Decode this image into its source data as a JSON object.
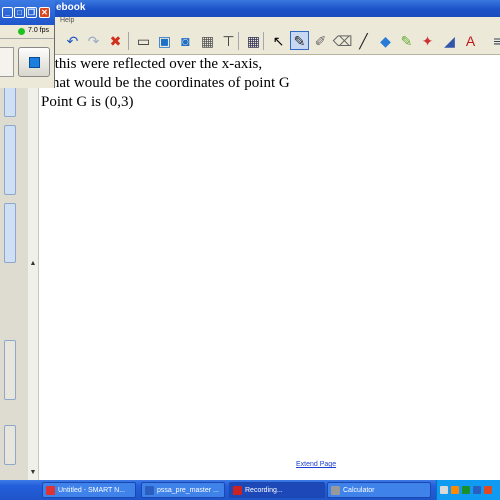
{
  "window": {
    "title_fragment": "ebook",
    "menu_help": "Help"
  },
  "toolbar": {
    "items": [
      {
        "name": "undo-icon",
        "glyph": "↶",
        "color": "#1e55c4"
      },
      {
        "name": "redo-icon",
        "glyph": "↷",
        "color": "#9aa9c4"
      },
      {
        "name": "delete-icon",
        "glyph": "✖",
        "color": "#d0301c"
      },
      {
        "name": "screen-shade-icon",
        "glyph": "▭",
        "color": "#333"
      },
      {
        "name": "display-icon",
        "glyph": "▣",
        "color": "#1e6fc8"
      },
      {
        "name": "projector-icon",
        "glyph": "◙",
        "color": "#1e6fc8"
      },
      {
        "name": "screen-capture-icon",
        "glyph": "▦",
        "color": "#555"
      },
      {
        "name": "tool-icon",
        "glyph": "⊤",
        "color": "#333"
      },
      {
        "name": "table-icon",
        "glyph": "▦",
        "color": "#335"
      },
      {
        "name": "select-arrow-icon",
        "glyph": "↖",
        "color": "#000"
      },
      {
        "name": "pen-icon",
        "glyph": "✎",
        "color": "#222"
      },
      {
        "name": "creative-pen-icon",
        "glyph": "✐",
        "color": "#6a6a6a"
      },
      {
        "name": "eraser-icon",
        "glyph": "⌫",
        "color": "#666"
      },
      {
        "name": "line-icon",
        "glyph": "╱",
        "color": "#222"
      },
      {
        "name": "shapes-icon",
        "glyph": "◆",
        "color": "#2a7ad8"
      },
      {
        "name": "fill-icon",
        "glyph": "✎",
        "color": "#6a3"
      },
      {
        "name": "magic-pen-icon",
        "glyph": "✦",
        "color": "#c33"
      },
      {
        "name": "color-fill-icon",
        "glyph": "◢",
        "color": "#35a"
      },
      {
        "name": "text-icon",
        "glyph": "A",
        "color": "#c0181a"
      },
      {
        "name": "properties-icon",
        "glyph": "≡",
        "color": "#345"
      }
    ]
  },
  "whiteboard": {
    "line1": "If this were reflected over the x-axis,",
    "line2": "what would be the coordinates of point G",
    "line3": "Point G is (0,3)",
    "extend_page": "Extend Page"
  },
  "recorder": {
    "fps": "7.0 fps"
  },
  "taskbar": {
    "tasks": [
      {
        "label": "Untitled - SMART N...",
        "icon_color": "#d33",
        "active": false
      },
      {
        "label": "pssa_pre_master ...",
        "icon_color": "#2a5fbf",
        "active": false
      },
      {
        "label": "Recording...",
        "icon_color": "#c22",
        "active": true
      },
      {
        "label": "Calculator",
        "icon_color": "#999",
        "active": false
      }
    ],
    "tray_colors": [
      "#d9d9d9",
      "#ff8a00",
      "#1b8f2a",
      "#2a5fbf",
      "#e04a20"
    ]
  }
}
